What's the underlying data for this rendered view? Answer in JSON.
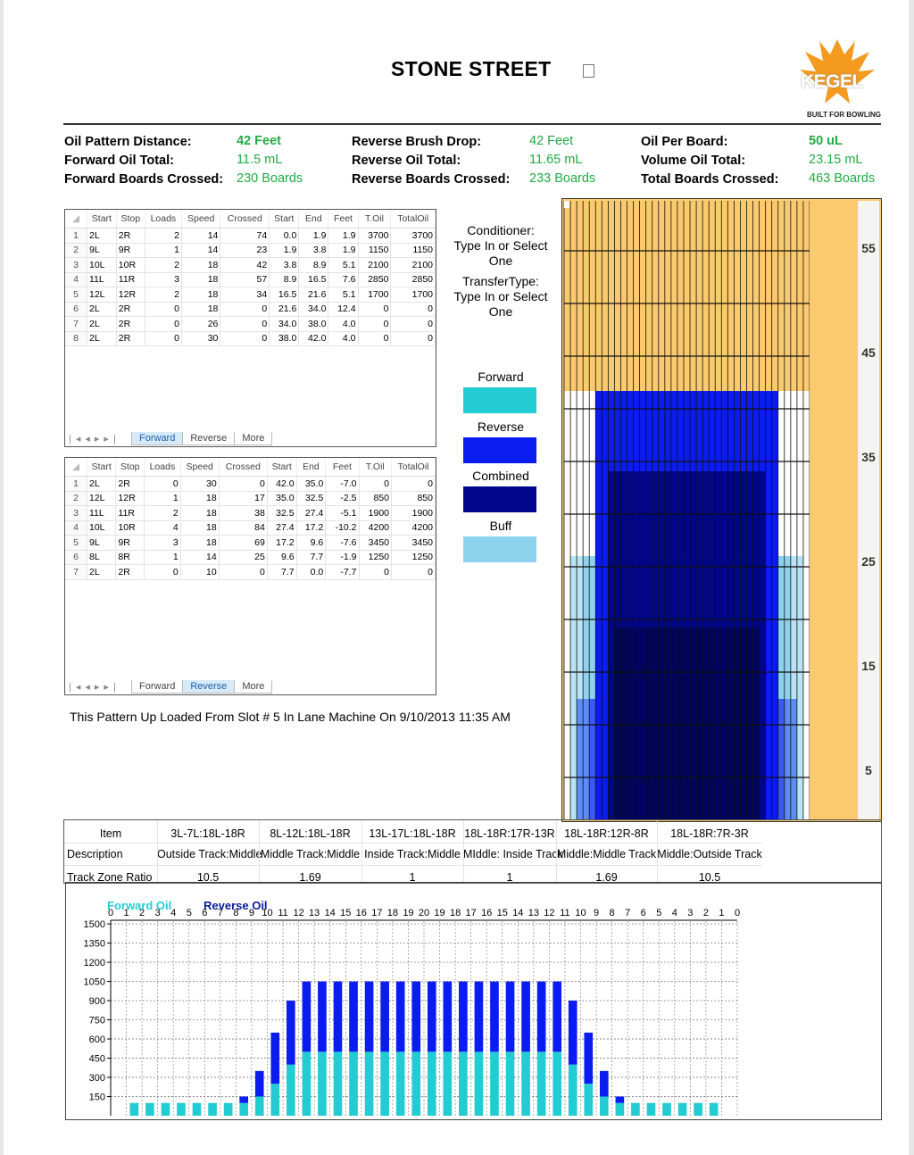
{
  "header": {
    "title": "STONE STREET",
    "logo_text": "KEGEL",
    "logo_tagline": "BUILT FOR BOWLING"
  },
  "stats": {
    "oil_pattern_distance": {
      "label": "Oil Pattern Distance:",
      "value": "42 Feet"
    },
    "forward_oil_total": {
      "label": "Forward Oil Total:",
      "value": "11.5 mL"
    },
    "forward_boards_crossed": {
      "label": "Forward Boards Crossed:",
      "value": "230 Boards"
    },
    "reverse_brush_drop": {
      "label": "Reverse Brush Drop:",
      "value": "42 Feet"
    },
    "reverse_oil_total": {
      "label": "Reverse Oil Total:",
      "value": "11.65 mL"
    },
    "reverse_boards_crossed": {
      "label": "Reverse Boards Crossed:",
      "value": "233 Boards"
    },
    "oil_per_board": {
      "label": "Oil Per Board:",
      "value": "50 uL"
    },
    "volume_oil_total": {
      "label": "Volume Oil Total:",
      "value": "23.15 mL"
    },
    "total_boards_crossed": {
      "label": "Total Boards Crossed:",
      "value": "463 Boards"
    }
  },
  "table_headers": [
    "Start",
    "Stop",
    "Loads",
    "Speed",
    "Crossed",
    "Start",
    "End",
    "Feet",
    "T.Oil",
    "TotalOil"
  ],
  "forward_table": {
    "rows": [
      [
        "1",
        "2L",
        "2R",
        "2",
        "14",
        "74",
        "0.0",
        "1.9",
        "1.9",
        "3700",
        "3700"
      ],
      [
        "2",
        "9L",
        "9R",
        "1",
        "14",
        "23",
        "1.9",
        "3.8",
        "1.9",
        "1150",
        "1150"
      ],
      [
        "3",
        "10L",
        "10R",
        "2",
        "18",
        "42",
        "3.8",
        "8.9",
        "5.1",
        "2100",
        "2100"
      ],
      [
        "4",
        "11L",
        "11R",
        "3",
        "18",
        "57",
        "8.9",
        "16.5",
        "7.6",
        "2850",
        "2850"
      ],
      [
        "5",
        "12L",
        "12R",
        "2",
        "18",
        "34",
        "16.5",
        "21.6",
        "5.1",
        "1700",
        "1700"
      ],
      [
        "6",
        "2L",
        "2R",
        "0",
        "18",
        "0",
        "21.6",
        "34.0",
        "12.4",
        "0",
        "0"
      ],
      [
        "7",
        "2L",
        "2R",
        "0",
        "26",
        "0",
        "34.0",
        "38.0",
        "4.0",
        "0",
        "0"
      ],
      [
        "8",
        "2L",
        "2R",
        "0",
        "30",
        "0",
        "38.0",
        "42.0",
        "4.0",
        "0",
        "0"
      ]
    ],
    "tabs": [
      "Forward",
      "Reverse",
      "More"
    ],
    "active_tab": 0
  },
  "reverse_table": {
    "rows": [
      [
        "1",
        "2L",
        "2R",
        "0",
        "30",
        "0",
        "42.0",
        "35.0",
        "-7.0",
        "0",
        "0"
      ],
      [
        "2",
        "12L",
        "12R",
        "1",
        "18",
        "17",
        "35.0",
        "32.5",
        "-2.5",
        "850",
        "850"
      ],
      [
        "3",
        "11L",
        "11R",
        "2",
        "18",
        "38",
        "32.5",
        "27.4",
        "-5.1",
        "1900",
        "1900"
      ],
      [
        "4",
        "10L",
        "10R",
        "4",
        "18",
        "84",
        "27.4",
        "17.2",
        "-10.2",
        "4200",
        "4200"
      ],
      [
        "5",
        "9L",
        "9R",
        "3",
        "18",
        "69",
        "17.2",
        "9.6",
        "-7.6",
        "3450",
        "3450"
      ],
      [
        "6",
        "8L",
        "8R",
        "1",
        "14",
        "25",
        "9.6",
        "7.7",
        "-1.9",
        "1250",
        "1250"
      ],
      [
        "7",
        "2L",
        "2R",
        "0",
        "10",
        "0",
        "7.7",
        "0.0",
        "-7.7",
        "0",
        "0"
      ]
    ],
    "tabs": [
      "Forward",
      "Reverse",
      "More"
    ],
    "active_tab": 1
  },
  "conditioner": {
    "conditioner_label": "Conditioner:",
    "conditioner_value": "Type In or Select One",
    "transfer_label": "TransferType:",
    "transfer_value": "Type In or Select One"
  },
  "legend": [
    {
      "label": "Forward",
      "color": "#22ccd2"
    },
    {
      "label": "Reverse",
      "color": "#0a1cf0"
    },
    {
      "label": "Combined",
      "color": "#00068a"
    },
    {
      "label": "Buff",
      "color": "#8dd3ee"
    }
  ],
  "note": "This Pattern Up Loaded From Slot # 5 In Lane Machine On 9/10/2013 11:35 AM",
  "lane_graph": {
    "distance_labels": [
      "55",
      "45",
      "35",
      "25",
      "15",
      "5"
    ],
    "colors": {
      "lane": "#fbca6e",
      "forward": "#22ccd2",
      "reverse": "#0a1cf0",
      "combined": "#00068a",
      "buff": "#8dd3ee"
    }
  },
  "zone_table": {
    "col_headers": [
      "3L-7L:18L-18R",
      "8L-12L:18L-18R",
      "13L-17L:18L-18R",
      "18L-18R:17R-13R",
      "18L-18R:12R-8R",
      "18L-18R:7R-3R"
    ],
    "descriptions": [
      "Outside Track:Middle",
      "Middle Track:Middle",
      "Inside Track:Middle",
      "MIddle: Inside Track",
      "Middle:Middle Track",
      "Middle:Outside Track"
    ],
    "ratios": [
      "10.5",
      "1.69",
      "1",
      "1",
      "1.69",
      "10.5"
    ],
    "row_labels": {
      "item": "Item",
      "description": "Description",
      "ratio": "Track Zone Ratio"
    }
  },
  "chart_data": {
    "type": "bar",
    "series": [
      {
        "name": "Forward Oil",
        "color": "#22ccd2",
        "values": [
          0,
          100,
          100,
          100,
          100,
          100,
          100,
          100,
          100,
          150,
          250,
          400,
          500,
          500,
          500,
          500,
          500,
          500,
          500,
          500,
          500,
          500,
          500,
          500,
          500,
          500,
          500,
          500,
          500,
          400,
          250,
          150,
          100,
          100,
          100,
          100,
          100,
          100,
          100,
          0
        ]
      },
      {
        "name": "Reverse Oil",
        "color": "#0a1cf0",
        "values": [
          0,
          0,
          0,
          0,
          0,
          0,
          0,
          0,
          50,
          200,
          400,
          500,
          550,
          550,
          550,
          550,
          550,
          550,
          550,
          550,
          550,
          550,
          550,
          550,
          550,
          550,
          550,
          550,
          550,
          500,
          400,
          200,
          50,
          0,
          0,
          0,
          0,
          0,
          0,
          0
        ]
      }
    ],
    "categories": [
      "0",
      "1",
      "2",
      "3",
      "4",
      "5",
      "6",
      "7",
      "8",
      "9",
      "10",
      "11",
      "12",
      "13",
      "14",
      "15",
      "16",
      "17",
      "18",
      "19",
      "20",
      "19",
      "18",
      "17",
      "16",
      "15",
      "14",
      "13",
      "12",
      "11",
      "10",
      "9",
      "8",
      "7",
      "6",
      "5",
      "4",
      "3",
      "2",
      "1",
      "0"
    ],
    "stacked": true,
    "y_ticks": [
      "1500",
      "1350",
      "1200",
      "1050",
      "900",
      "750",
      "600",
      "450",
      "300",
      "150"
    ],
    "ylim": [
      0,
      1500
    ],
    "grid": true,
    "legend_position": "top-left"
  }
}
